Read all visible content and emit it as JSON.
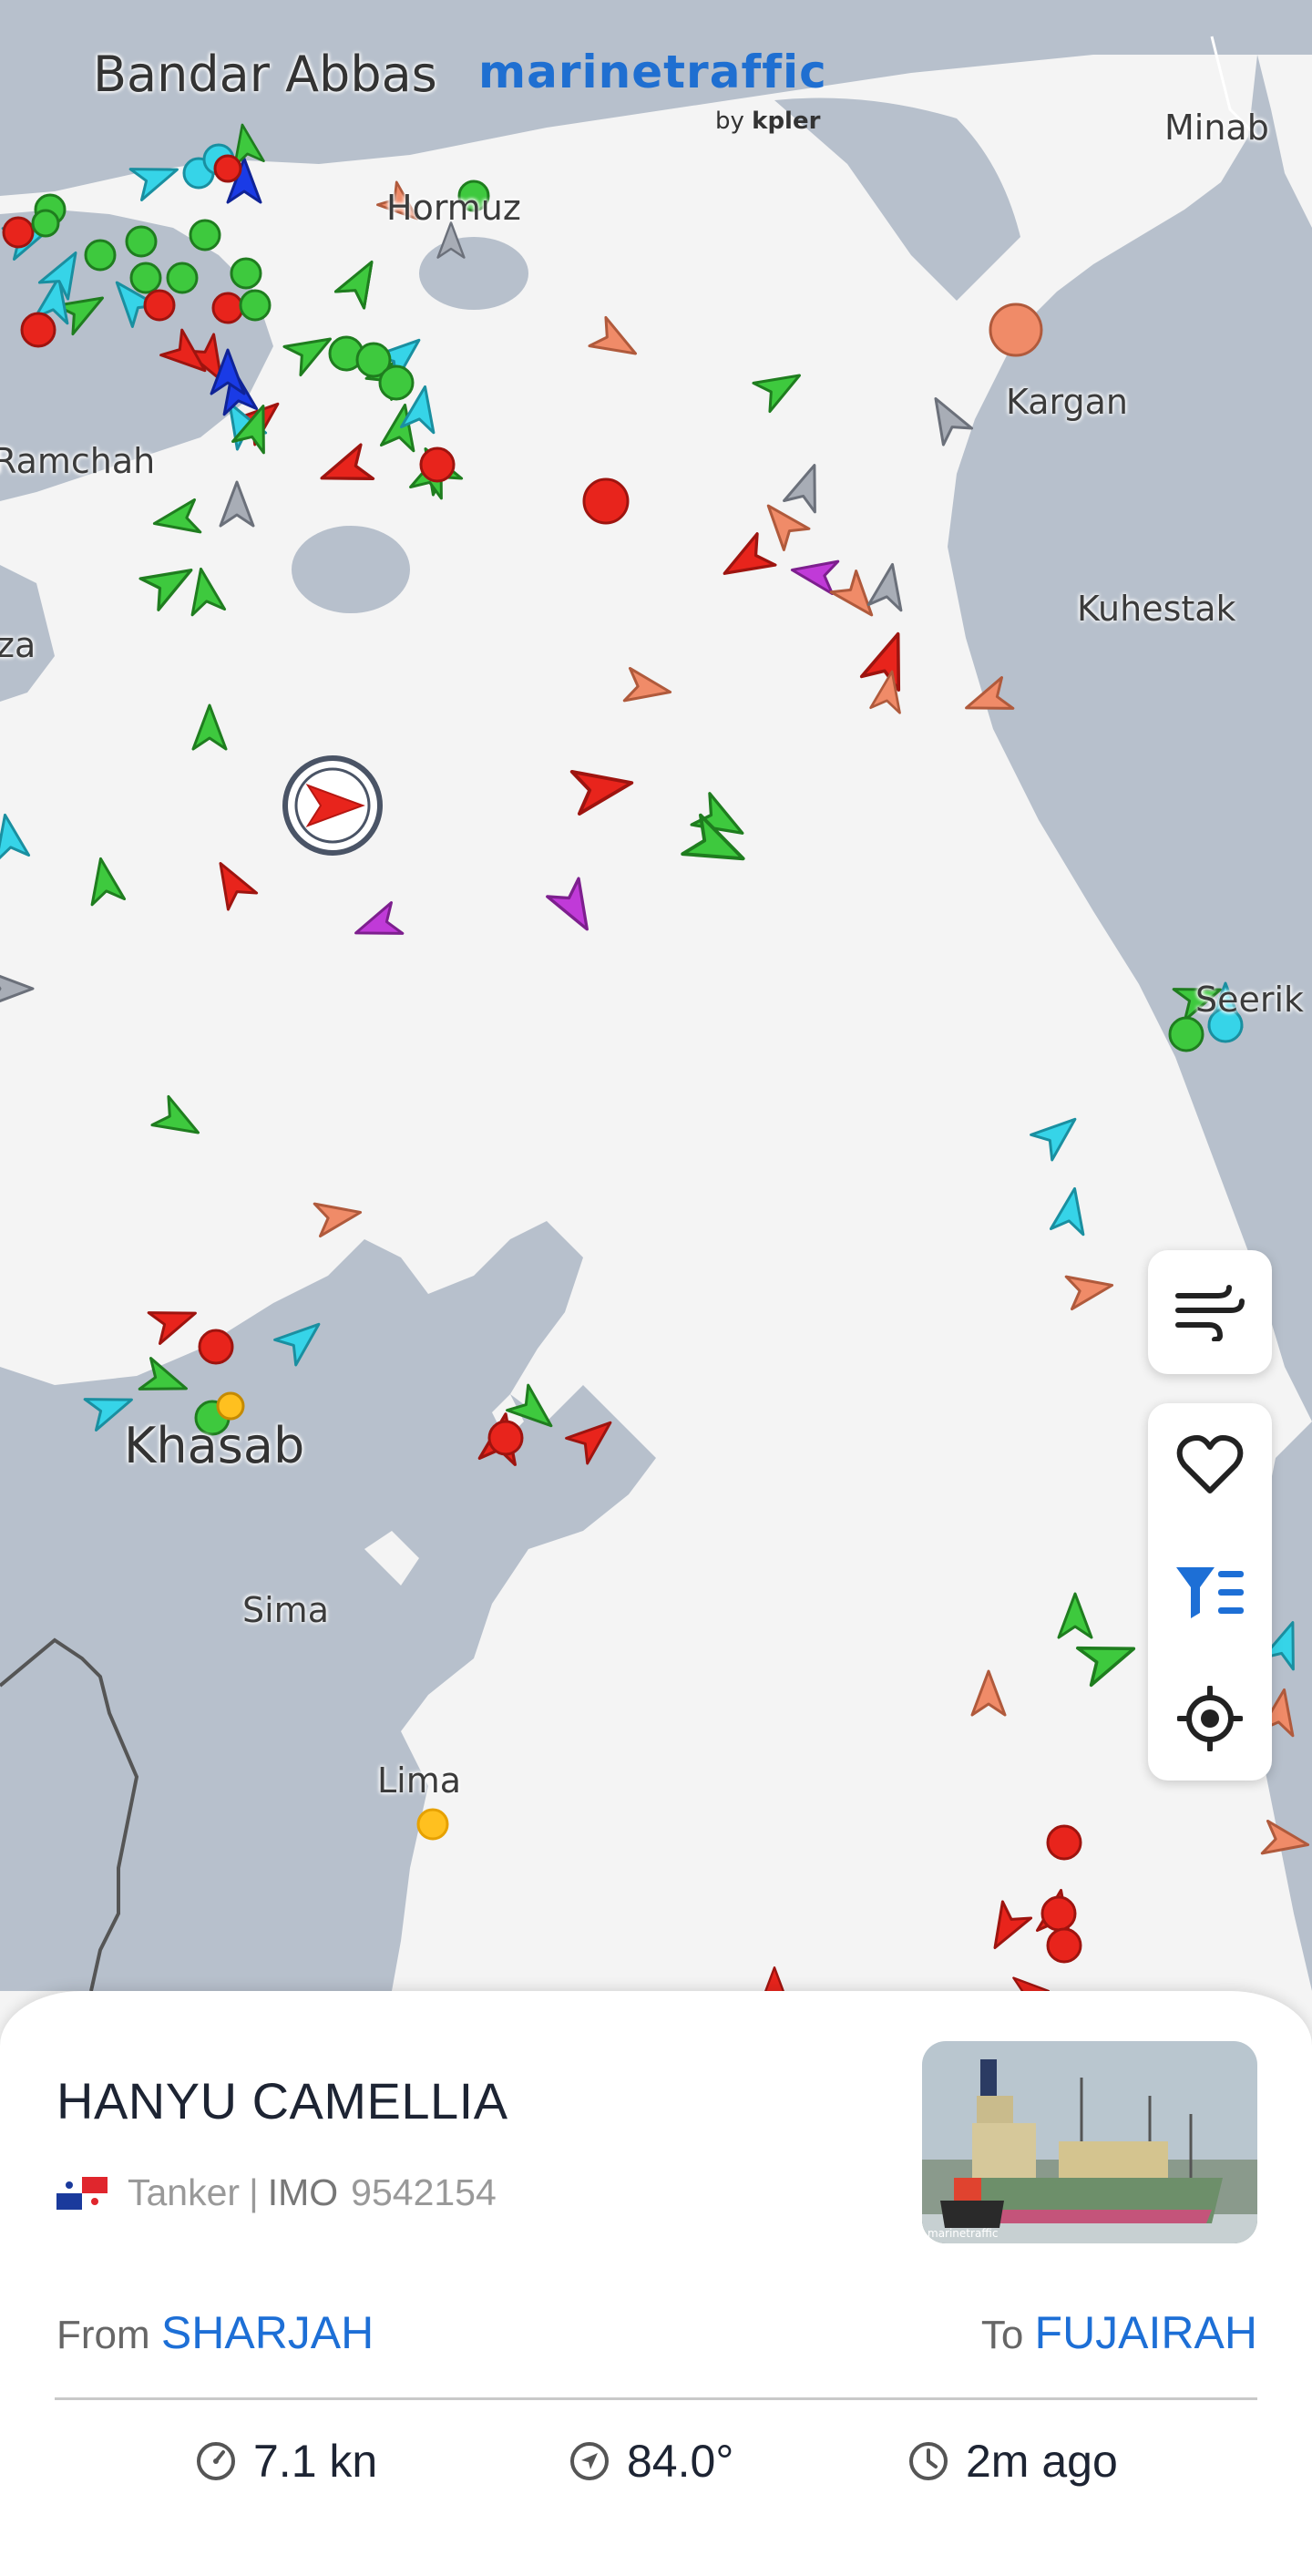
{
  "map": {
    "brand": {
      "name": "marinetraffic",
      "sub_by": "by",
      "sub_company": "kpler"
    },
    "places": [
      {
        "id": "bandar-abbas",
        "label": "Bandar Abbas"
      },
      {
        "id": "minab",
        "label": "Minab"
      },
      {
        "id": "hormuz",
        "label": "Hormuz"
      },
      {
        "id": "kargan",
        "label": "Kargan"
      },
      {
        "id": "ramchah",
        "label": "Ramchah"
      },
      {
        "id": "kuhestak",
        "label": "Kuhestak"
      },
      {
        "id": "za",
        "label": "za"
      },
      {
        "id": "seerik",
        "label": "Seerik"
      },
      {
        "id": "khasab",
        "label": "Khasab"
      },
      {
        "id": "sima",
        "label": "Sima"
      },
      {
        "id": "lima",
        "label": "Lima"
      }
    ],
    "colors": {
      "sea": "#f4f4f4",
      "land": "#b7c0cc",
      "cargo_green": "#3ec93e",
      "tanker_red": "#e8241c",
      "fishing_orange": "#f08b68",
      "passenger_blue": "#1a3be6",
      "tug_cyan": "#36d4e8",
      "pleasure_purple": "#c03ad8",
      "unknown_gray": "#a8adb6",
      "hsc_yellow": "#ffc01f"
    }
  },
  "controls": {
    "wind_icon": "wind-icon",
    "favorite_icon": "heart-icon",
    "filter_icon": "filter-icon",
    "locate_icon": "crosshair-icon"
  },
  "vessel": {
    "name": "HANYU CAMELLIA",
    "flag_icon": "panama-flag-icon",
    "type": "Tanker",
    "separator": "|",
    "imo_label": "IMO",
    "imo": "9542154",
    "from_label": "From",
    "from_port": "SHARJAH",
    "to_label": "To",
    "to_port": "FUJAIRAH",
    "speed": "7.1 kn",
    "course": "84.0°",
    "last_seen": "2m ago"
  }
}
